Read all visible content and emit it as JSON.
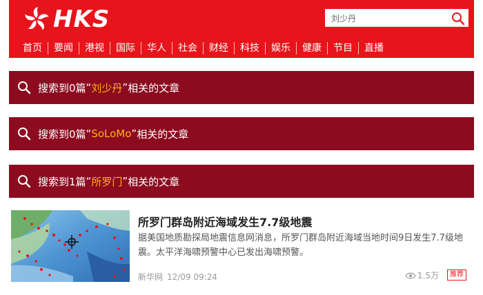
{
  "header": {
    "logo_text": "HKS",
    "search": {
      "value": "刘少丹",
      "placeholder": ""
    },
    "nav": [
      "首页",
      "要闻",
      "港视",
      "国际",
      "华人",
      "社会",
      "财经",
      "科技",
      "娱乐",
      "健康",
      "节目",
      "直播"
    ]
  },
  "results": [
    {
      "prefix": "搜索到0篇",
      "open_quote": "“",
      "keyword": "刘少丹",
      "close_quote": "”",
      "suffix": "相关的文章"
    },
    {
      "prefix": "搜索到0篇",
      "open_quote": "“",
      "keyword": "SoLoMo",
      "close_quote": "”",
      "suffix": "相关的文章"
    },
    {
      "prefix": "搜索到1篇",
      "open_quote": "“",
      "keyword": "所罗门",
      "close_quote": "”",
      "suffix": "相关的文章"
    }
  ],
  "article": {
    "title": "所罗门群岛附近海域发生7.7级地震",
    "summary": "据美国地质勘探局地震信息网消息，所罗门群岛附近海域当地时间9日发生7.7级地震。太平洋海啸预警中心已发出海啸预警。",
    "source": "新华网",
    "time": "12/09 09:24",
    "views": "1.5万",
    "tag": "推荐"
  },
  "colors": {
    "header_red": "#e8141b",
    "banner_red": "#8c0b1f",
    "keyword_orange": "#ffb31a"
  },
  "icons": [
    "bauhinia-logo-icon",
    "search-icon",
    "eye-icon"
  ]
}
